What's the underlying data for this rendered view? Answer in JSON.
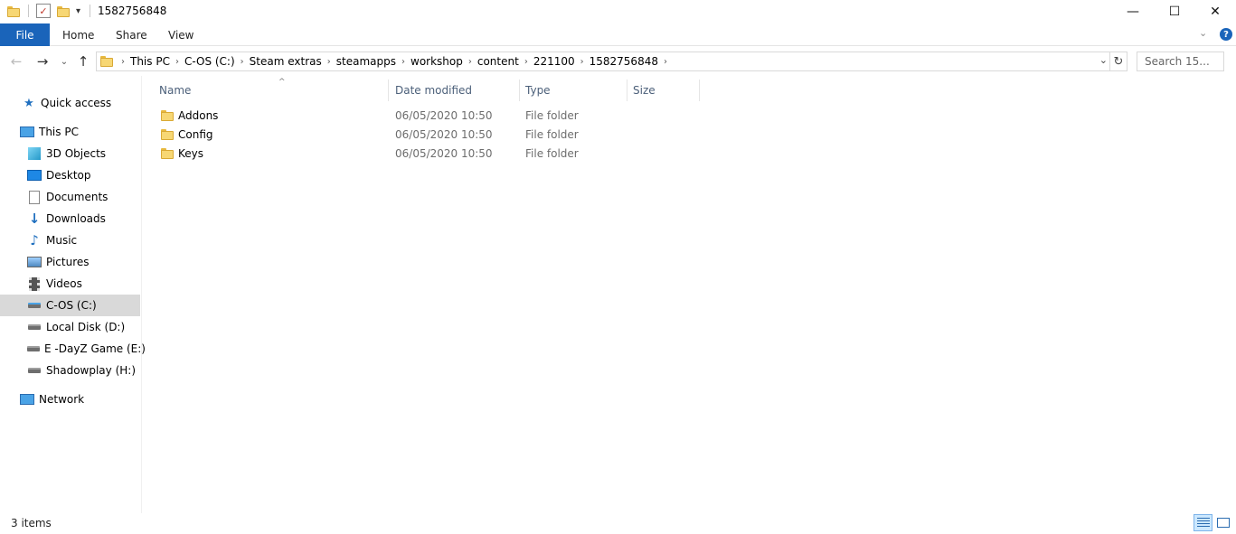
{
  "window": {
    "title": "1582756848",
    "minimize_glyph": "—",
    "maximize_glyph": "☐",
    "close_glyph": "✕"
  },
  "ribbon": {
    "file_label": "File",
    "tabs": [
      "Home",
      "Share",
      "View"
    ],
    "help_glyph": "?"
  },
  "nav": {
    "back_glyph": "←",
    "forward_glyph": "→",
    "recent_glyph": "⌄",
    "up_glyph": "↑",
    "breadcrumbs": [
      "This PC",
      "C-OS (C:)",
      "Steam extras",
      "steamapps",
      "workshop",
      "content",
      "221100",
      "1582756848"
    ],
    "crumb_separator": "›",
    "dropdown_glyph": "⌄",
    "refresh_glyph": "↻",
    "search_placeholder": "Search 15..."
  },
  "sidebar": {
    "items": [
      {
        "label": "Quick access",
        "icon": "star-icon"
      },
      {
        "label": "This PC",
        "icon": "computer-icon"
      },
      {
        "label": "3D Objects",
        "icon": "cube-icon"
      },
      {
        "label": "Desktop",
        "icon": "desktop-icon"
      },
      {
        "label": "Documents",
        "icon": "documents-icon"
      },
      {
        "label": "Downloads",
        "icon": "download-icon"
      },
      {
        "label": "Music",
        "icon": "music-icon"
      },
      {
        "label": "Pictures",
        "icon": "pictures-icon"
      },
      {
        "label": "Videos",
        "icon": "videos-icon"
      },
      {
        "label": "C-OS (C:)",
        "icon": "system-drive-icon"
      },
      {
        "label": "Local Disk (D:)",
        "icon": "drive-icon"
      },
      {
        "label": "E -DayZ Game (E:)",
        "icon": "drive-icon"
      },
      {
        "label": "Shadowplay (H:)",
        "icon": "drive-icon"
      },
      {
        "label": "Network",
        "icon": "network-icon"
      }
    ],
    "selected": "C-OS (C:)"
  },
  "columns": [
    "Name",
    "Date modified",
    "Type",
    "Size"
  ],
  "files": [
    {
      "name": "Addons",
      "modified": "06/05/2020 10:50",
      "type": "File folder",
      "size": ""
    },
    {
      "name": "Config",
      "modified": "06/05/2020 10:50",
      "type": "File folder",
      "size": ""
    },
    {
      "name": "Keys",
      "modified": "06/05/2020 10:50",
      "type": "File folder",
      "size": ""
    }
  ],
  "status": {
    "item_count": "3 items"
  },
  "colors": {
    "accent": "#1a64ba",
    "selection": "#d9d9d9",
    "header_text": "#4c607a",
    "folder": "#f7d774"
  }
}
